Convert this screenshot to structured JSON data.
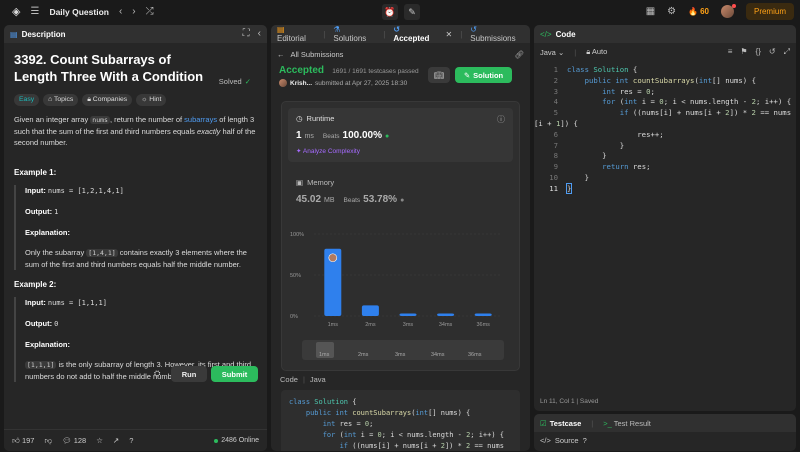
{
  "topbar": {
    "title": "Daily Question",
    "streak": "60",
    "premium": "Premium"
  },
  "description": {
    "tab_label": "Description",
    "title": "3392. Count Subarrays of Length Three With a Condition",
    "solved": "Solved",
    "tags": [
      "Easy",
      "Topics",
      "Companies",
      "Hint"
    ],
    "statement_1": "Given an integer array ",
    "statement_code": "nums",
    "statement_2": ", return the number of ",
    "statement_link": "subarrays",
    "statement_3": " of length 3 such that the sum of the first and third numbers equals ",
    "statement_em": "exactly",
    "statement_4": " half of the second number.",
    "example1": {
      "heading": "Example 1:",
      "input_label": "Input:",
      "input": "nums = [1,2,1,4,1]",
      "output_label": "Output:",
      "output": "1",
      "expl_label": "Explanation:",
      "expl_1": "Only the subarray ",
      "expl_code": "[1,4,1]",
      "expl_2": " contains exactly 3 elements where the sum of the first and third numbers equals half the middle number."
    },
    "example2": {
      "heading": "Example 2:",
      "input_label": "Input:",
      "input": "nums = [1,1,1]",
      "output_label": "Output:",
      "output": "0",
      "expl_label": "Explanation:",
      "expl_code": "[1,1,1]",
      "expl_2": " is the only subarray of length 3. However, its first and third numbers do not add to half the middle number."
    },
    "footer": {
      "likes": "197",
      "comments": "128",
      "online": "2486 Online"
    }
  },
  "middle": {
    "tabs": [
      "Editorial",
      "Solutions",
      "Accepted",
      "Submissions"
    ],
    "back_label": "All Submissions",
    "status": "Accepted",
    "testcases": "1691 / 1691 testcases passed",
    "user": "Krish...",
    "submitted": "submitted at Apr 27, 2025 18:30",
    "solution_btn": "Solution",
    "runtime_label": "Runtime",
    "runtime_value": "1",
    "runtime_unit": "ms",
    "beats_label": "Beats",
    "runtime_beats": "100.00%",
    "analyze": "Analyze Complexity",
    "memory_label": "Memory",
    "memory_value": "45.02",
    "memory_unit": "MB",
    "memory_beats": "53.78%",
    "code_label": "Code",
    "code_lang": "Java"
  },
  "chart_data": {
    "type": "bar",
    "categories": [
      "1ms",
      "2ms",
      "3ms",
      "34ms",
      "36ms"
    ],
    "values": [
      82,
      13,
      3,
      3,
      3
    ],
    "ylim": [
      0,
      100
    ],
    "yticks": [
      "100%",
      "50%",
      "0%"
    ],
    "colors": {
      "bar": "#2f80ed"
    }
  },
  "editor": {
    "tab_label": "Code",
    "lang": "Java",
    "mode": "Auto",
    "status": "Ln 11, Col 1",
    "saved": "Saved",
    "run": "Run",
    "submit": "Submit",
    "lines": [
      "class Solution {",
      "    public int countSubarrays(int[] nums) {",
      "        int res = 0;",
      "        for (int i = 0; i < nums.length - 2; i++) {",
      "            if ((nums[i] + nums[i + 2]) * 2 == nums",
      "[i + 1]) {",
      "                res++;",
      "            }",
      "        }",
      "        return res;",
      "    }",
      "}"
    ],
    "line_numbers": [
      "1",
      "2",
      "3",
      "4",
      "5",
      "",
      "6",
      "7",
      "8",
      "9",
      "10",
      "11"
    ]
  },
  "testcase": {
    "tab1": "Testcase",
    "tab2": "Test Result",
    "source": "Source"
  },
  "colors": {
    "accent_green": "#2cbb5d",
    "accent_orange": "#ffa116",
    "link_blue": "#4f9cf2"
  }
}
